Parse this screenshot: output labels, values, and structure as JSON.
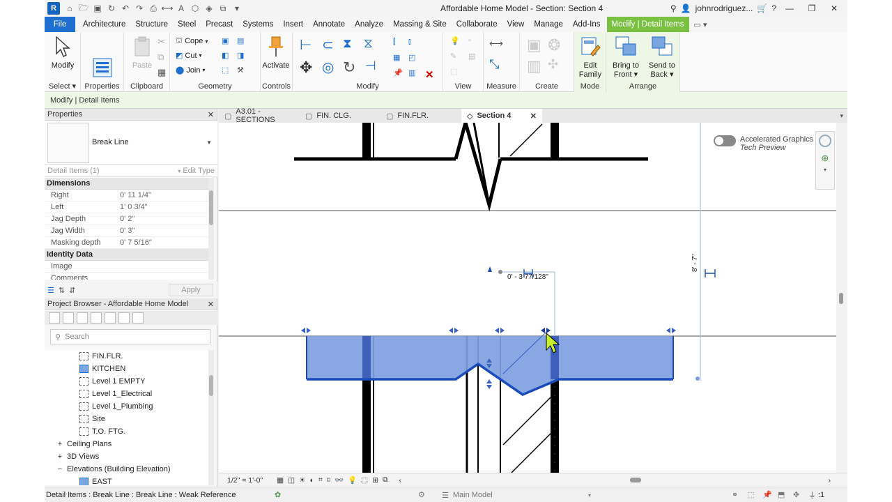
{
  "window": {
    "title": "Affordable Home Model - Section: Section 4",
    "user": "johnrodriguez...",
    "app_logo": "R"
  },
  "ribbon_tabs": [
    "File",
    "Architecture",
    "Structure",
    "Steel",
    "Precast",
    "Systems",
    "Insert",
    "Annotate",
    "Analyze",
    "Massing & Site",
    "Collaborate",
    "View",
    "Manage",
    "Add-Ins",
    "Modify | Detail Items"
  ],
  "ribbon": {
    "select": {
      "modify_label": "Modify",
      "panel": "Select"
    },
    "properties": {
      "panel": "Properties"
    },
    "clipboard": {
      "paste": "Paste",
      "panel": "Clipboard"
    },
    "geometry": {
      "cope": "Cope",
      "cut": "Cut",
      "join": "Join",
      "panel": "Geometry"
    },
    "controls": {
      "activate": "Activate",
      "panel": "Controls"
    },
    "modify": {
      "panel": "Modify"
    },
    "view": {
      "panel": "View"
    },
    "measure": {
      "panel": "Measure"
    },
    "create": {
      "panel": "Create"
    },
    "mode": {
      "edit_family_1": "Edit",
      "edit_family_2": "Family",
      "panel": "Mode"
    },
    "arrange": {
      "bring_1": "Bring to",
      "bring_2": "Front",
      "send_1": "Send to",
      "send_2": "Back",
      "panel": "Arrange"
    }
  },
  "options_bar": {
    "label": "Modify | Detail Items"
  },
  "properties": {
    "title": "Properties",
    "type_name": "Break Line",
    "instance_filter": "Detail Items (1)",
    "edit_type": "Edit Type",
    "groups": [
      {
        "name": "Dimensions",
        "rows": [
          {
            "k": "Right",
            "v": "0'  11 1/4\""
          },
          {
            "k": "Left",
            "v": "1'  0 3/4\""
          },
          {
            "k": "Jag Depth",
            "v": "0'  2\""
          },
          {
            "k": "Jag Width",
            "v": "0'  3\""
          },
          {
            "k": "Masking depth",
            "v": "0'  7 5/16\""
          }
        ]
      },
      {
        "name": "Identity Data",
        "rows": [
          {
            "k": "Image",
            "v": ""
          },
          {
            "k": "Comments",
            "v": ""
          }
        ]
      }
    ],
    "apply": "Apply"
  },
  "browser": {
    "title": "Project Browser - Affordable Home Model",
    "search_placeholder": "Search",
    "items": [
      {
        "label": "FIN.FLR.",
        "indent": 2,
        "kind": "view"
      },
      {
        "label": "KITCHEN",
        "indent": 2,
        "kind": "view-sel"
      },
      {
        "label": "Level 1 EMPTY",
        "indent": 2,
        "kind": "view"
      },
      {
        "label": "Level 1_Electrical",
        "indent": 2,
        "kind": "view"
      },
      {
        "label": "Level 1_Plumbing",
        "indent": 2,
        "kind": "view"
      },
      {
        "label": "Site",
        "indent": 2,
        "kind": "view"
      },
      {
        "label": "T.O. FTG.",
        "indent": 2,
        "kind": "view"
      },
      {
        "label": "Ceiling Plans",
        "indent": 1,
        "kind": "plus"
      },
      {
        "label": "3D Views",
        "indent": 1,
        "kind": "plus"
      },
      {
        "label": "Elevations (Building Elevation)",
        "indent": 1,
        "kind": "minus"
      },
      {
        "label": "EAST",
        "indent": 2,
        "kind": "view-sel"
      }
    ]
  },
  "view_tabs": [
    {
      "label": "A3.01 - SECTIONS",
      "active": false
    },
    {
      "label": "FIN. CLG.",
      "active": false
    },
    {
      "label": "FIN.FLR.",
      "active": false
    },
    {
      "label": "Section 4",
      "active": true
    }
  ],
  "canvas": {
    "dimension_text": "0' - 3 77/128\"",
    "vertical_dim": "8' - 7\"",
    "accel_graphics_1": "Accelerated Graphics",
    "accel_graphics_2": "Tech Preview"
  },
  "view_control_bar": {
    "scale": "1/2\" = 1'-0\""
  },
  "status": {
    "message": "Detail Items : Break Line : Break Line : Weak Reference",
    "workset": "Main Model",
    "filter_count": ":1"
  },
  "colors": {
    "accent": "#1e6fcf",
    "context_tab": "#7ac142",
    "break_fill": "#7f9fe0",
    "break_edge": "#1a4dbb"
  }
}
